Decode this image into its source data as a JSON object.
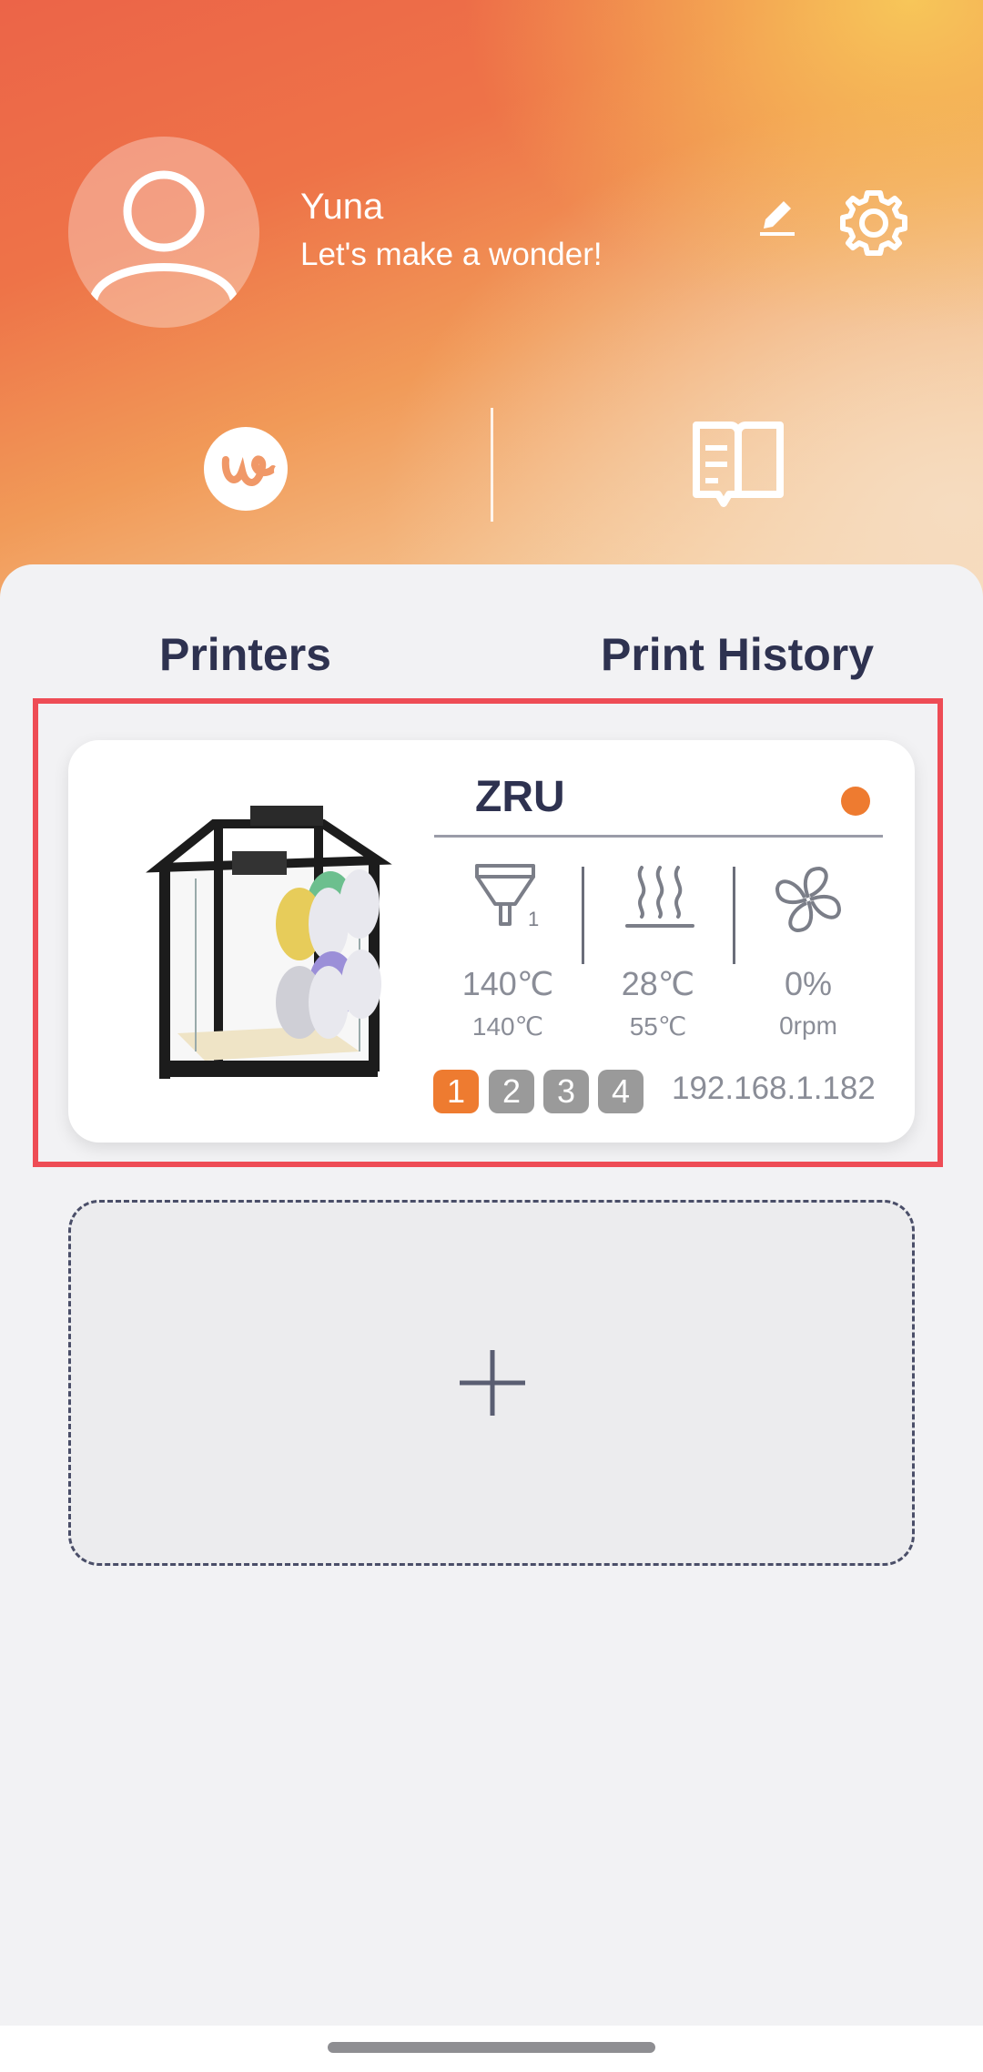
{
  "profile": {
    "name": "Yuna",
    "motto": "Let's make a wonder!"
  },
  "icons": {
    "avatar": "user-avatar-icon",
    "edit": "pencil-icon",
    "settings": "gear-icon",
    "quick_left": "wondermaker-logo-icon",
    "quick_right": "manual-book-icon",
    "nozzle": "nozzle-icon",
    "bed": "heated-bed-icon",
    "fan": "fan-icon",
    "add": "plus-icon"
  },
  "tabs": {
    "printers": "Printers",
    "history": "Print History"
  },
  "printer": {
    "name": "ZRU",
    "status_color": "#ee7b30",
    "nozzle_index": "1",
    "nozzle_temp": "140℃",
    "nozzle_target": "140℃",
    "bed_temp": "28℃",
    "bed_target": "55℃",
    "fan_percent": "0%",
    "fan_rpm": "0rpm",
    "slots": [
      "1",
      "2",
      "3",
      "4"
    ],
    "active_slot": "1",
    "ip": "192.168.1.182"
  },
  "colors": {
    "accent": "#ee7b30",
    "highlight": "#ee4c55",
    "text_dark": "#2e3250"
  }
}
